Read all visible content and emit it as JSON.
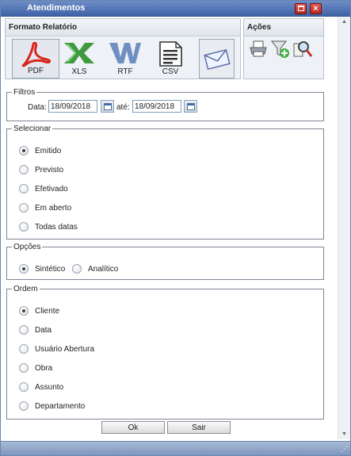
{
  "window": {
    "title": "Atendimentos"
  },
  "formato": {
    "title": "Formato Relatório",
    "items": [
      {
        "label": "PDF",
        "icon": "pdf-icon"
      },
      {
        "label": "XLS",
        "icon": "xls-icon"
      },
      {
        "label": "RTF",
        "icon": "rtf-icon"
      },
      {
        "label": "CSV",
        "icon": "csv-icon"
      },
      {
        "label": "",
        "icon": "email-icon"
      }
    ]
  },
  "acoes": {
    "title": "Ações",
    "items": [
      "printer-icon",
      "add-filter-icon",
      "preview-icon"
    ]
  },
  "filtros": {
    "legend": "Filtros",
    "data_label": "Data:",
    "data_inicio": "18/09/2018",
    "ate_label": "até:",
    "data_fim": "18/09/2018"
  },
  "selecionar": {
    "legend": "Selecionar",
    "options": [
      "Emitido",
      "Previsto",
      "Efetivado",
      "Em aberto",
      "Todas datas"
    ],
    "selected": "Emitido"
  },
  "opcoes": {
    "legend": "Opções",
    "options": [
      "Sintético",
      "Analítico"
    ],
    "selected": "Sintético"
  },
  "ordem": {
    "legend": "Ordem",
    "options": [
      "Cliente",
      "Data",
      "Usuário Abertura",
      "Obra",
      "Assunto",
      "Departamento"
    ],
    "selected": "Cliente"
  },
  "buttons": {
    "ok": "Ok",
    "sair": "Sair"
  },
  "colors": {
    "title_bar": "#4f72b3",
    "window_controls": "#c9352a",
    "panel_bg": "#eef1f5"
  }
}
